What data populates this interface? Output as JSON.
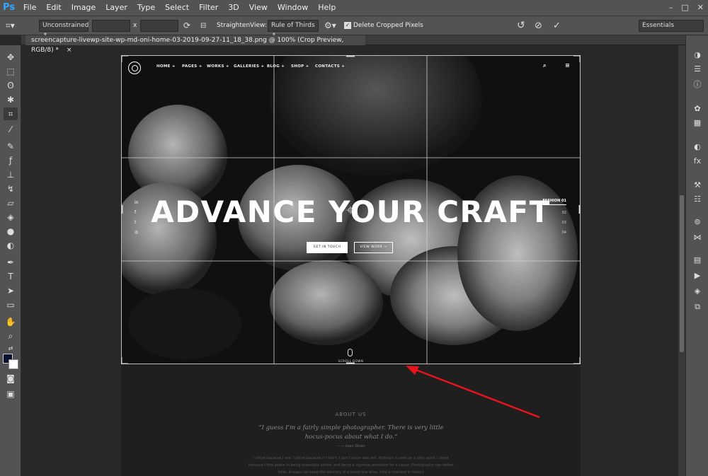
{
  "menubar": {
    "logo": "Ps",
    "items": [
      "File",
      "Edit",
      "Image",
      "Layer",
      "Type",
      "Select",
      "Filter",
      "3D",
      "View",
      "Window",
      "Help"
    ],
    "window_controls": [
      "–",
      "□",
      "✕"
    ]
  },
  "options": {
    "ratio_value": "Unconstrained",
    "x_label": "x",
    "straighten_label": "Straighten",
    "view_label": "View:",
    "view_value": "Rule of Thirds",
    "delete_cropped_label": "Delete Cropped Pixels",
    "delete_cropped_checked": true,
    "workspace_value": "Essentials"
  },
  "document": {
    "tab_title": "screencapture-livewp-site-wp-md-oni-home-03-2019-09-27-11_18_38.png @ 100% (Crop Preview, RGB/8) *",
    "tab_close": "×"
  },
  "colors": {
    "foreground": "#0b1230",
    "background": "#ffffff",
    "accent_arrow": "#e8141c"
  },
  "site": {
    "nav": [
      "HOME +",
      "PAGES +",
      "WORKS +",
      "GALLERIES +",
      "BLOG +",
      "SHOP +",
      "CONTACTS +"
    ],
    "hero_title": "ADVANCE YOUR CRAFT",
    "btn_primary": "GET IN TOUCH",
    "btn_secondary": "VIEW WORK →",
    "social": [
      "in",
      "f",
      "t",
      "◎"
    ],
    "slides": [
      "FASHION  01",
      "02",
      "03",
      "04"
    ],
    "scroll_down": "SCROLL DOWN",
    "about_label": "ABOUT US",
    "about_quote": "“I guess I’m a fairly simple photographer. There is very little hocus-pocus about what I do.”",
    "about_author": "——  Joan Bean",
    "about_body": "I shoot because I see. I shoot because if I don’t, I don’t know who will. Activism is seen as a dirty word. I shoot because I find peace in being especially active, and being a vigorous advocate for a cause. Photography can defeat time. Images can keep the memory of a loved one alive, hold a moment in history"
  }
}
